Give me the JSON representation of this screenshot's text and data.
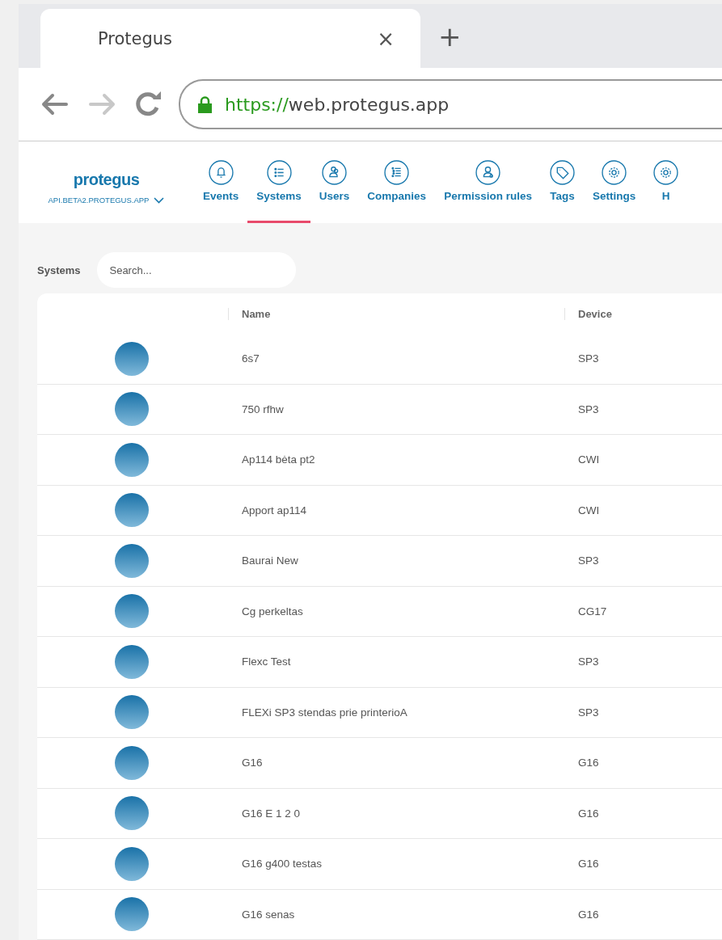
{
  "browser": {
    "tab_title": "Protegus",
    "tab_close": "×",
    "new_tab": "+",
    "url_scheme": "https://",
    "url_rest": "web.protegus.app"
  },
  "app": {
    "logo": "protegus",
    "server": "API.BETA2.PROTEGUS.APP",
    "nav": [
      {
        "label": "Events",
        "kind": "bell",
        "selected": false
      },
      {
        "label": "Systems",
        "kind": "list",
        "selected": true
      },
      {
        "label": "Users",
        "kind": "users",
        "selected": false
      },
      {
        "label": "Companies",
        "kind": "list2",
        "selected": false
      },
      {
        "label": "Permission rules",
        "kind": "user",
        "selected": false
      },
      {
        "label": "Tags",
        "kind": "tag",
        "selected": false
      },
      {
        "label": "Settings",
        "kind": "gear",
        "selected": false
      },
      {
        "label": "H",
        "kind": "gear",
        "selected": false
      }
    ]
  },
  "systems": {
    "title": "Systems",
    "search": {
      "placeholder": "Search..."
    },
    "columns": [
      "Name",
      "Device"
    ],
    "rows": [
      [
        "6s7",
        "SP3"
      ],
      [
        "750 rfhw",
        "SP3"
      ],
      [
        "Ap114 bėta pt2",
        "CWI"
      ],
      [
        "Apport ap114",
        "CWI"
      ],
      [
        "Baurai New",
        "SP3"
      ],
      [
        "Cg perkeltas",
        "CG17"
      ],
      [
        "Flexc Test",
        "SP3"
      ],
      [
        "FLEXi SP3 stendas prie printerioA",
        "SP3"
      ],
      [
        "G16",
        "G16"
      ],
      [
        "G16 E 1 2 0",
        "G16"
      ],
      [
        "G16 g400 testas",
        "G16"
      ],
      [
        "G16 senas",
        "G16"
      ]
    ]
  }
}
